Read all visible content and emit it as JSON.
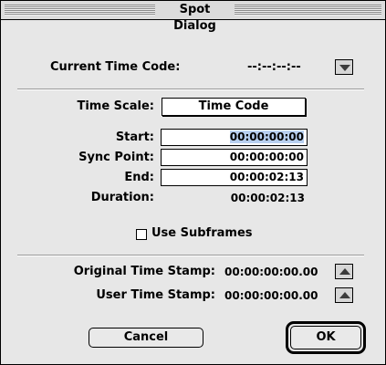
{
  "window": {
    "title": "Spot Dialog"
  },
  "current_time_code": {
    "label": "Current Time Code:",
    "value": "--:--:--:--"
  },
  "time_scale": {
    "label": "Time Scale:",
    "value": "Time Code"
  },
  "fields": {
    "start": {
      "label": "Start:",
      "value": "00:00:00:00"
    },
    "sync_point": {
      "label": "Sync Point:",
      "value": "00:00:00:00"
    },
    "end": {
      "label": "End:",
      "value": "00:00:02:13"
    }
  },
  "duration": {
    "label": "Duration:",
    "value": "00:00:02:13"
  },
  "subframes": {
    "label": "Use Subframes",
    "checked": false
  },
  "timestamps": {
    "original": {
      "label": "Original Time Stamp:",
      "value": "00:00:00:00.00"
    },
    "user": {
      "label": "User Time Stamp:",
      "value": "00:00:00:00.00"
    }
  },
  "buttons": {
    "cancel": "Cancel",
    "ok": "OK"
  },
  "icons": {
    "current_time_code": "triangle-down-icon",
    "original_time_stamp": "triangle-up-icon",
    "user_time_stamp": "triangle-up-icon"
  },
  "colors": {
    "selection": "#b8d0f0"
  }
}
